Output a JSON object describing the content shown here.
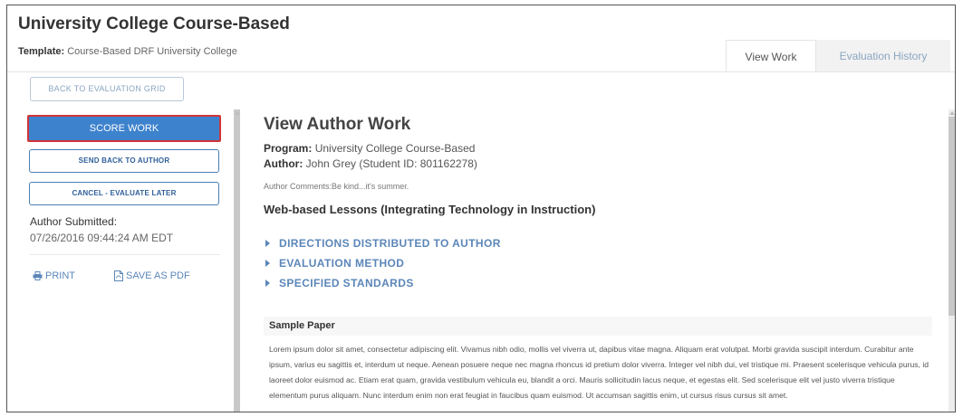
{
  "header": {
    "title": "University College Course-Based",
    "template_label": "Template:",
    "template_value": "Course-Based DRF University College"
  },
  "tabs": [
    {
      "label": "View Work",
      "active": true
    },
    {
      "label": "Evaluation History",
      "active": false
    }
  ],
  "back_button": "BACK TO EVALUATION GRID",
  "sidebar": {
    "score_button": "SCORE WORK",
    "send_back_button": "SEND BACK TO AUTHOR",
    "cancel_button": "CANCEL - EVALUATE LATER",
    "submitted_label": "Author Submitted:",
    "submitted_date": "07/26/2016 09:44:24 AM EDT",
    "print_label": "PRINT",
    "pdf_label": "SAVE AS PDF"
  },
  "main": {
    "title": "View Author Work",
    "program_label": "Program:",
    "program_value": "University College Course-Based",
    "author_label": "Author:",
    "author_value": "John Grey (Student ID: 801162278)",
    "comments": "Author Comments:Be kind...it's summer.",
    "lesson_title": "Web-based Lessons (Integrating Technology in Instruction)",
    "sections": [
      "DIRECTIONS DISTRIBUTED TO AUTHOR",
      "EVALUATION METHOD",
      "SPECIFIED STANDARDS"
    ],
    "paper_title": "Sample Paper",
    "paper_text": "Lorem ipsum dolor sit amet, consectetur adipiscing elit. Vivamus nibh odio, mollis vel viverra ut, dapibus vitae magna. Aliquam erat volutpat. Morbi gravida suscipit interdum. Curabitur ante ipsum, varius eu sagittis et, interdum ut neque. Aenean posuere neque nec magna rhoncus id pretium dolor viverra. Integer vel nibh dui, vel tristique mi. Praesent scelerisque vehicula purus, id laoreet dolor euismod ac. Etiam erat quam, gravida vestibulum vehicula eu, blandit a orci. Mauris sollicitudin lacus neque, et egestas elit. Sed scelerisque elit vel justo viverra tristique elementum purus aliquam. Nunc interdum enim non erat feugiat in faucibus quam euismod. Ut accumsan sagittis enim, ut cursus risus cursus sit amet."
  },
  "colors": {
    "primary": "#3d82cc",
    "link": "#5b86b8",
    "highlight_border": "#d13438"
  }
}
